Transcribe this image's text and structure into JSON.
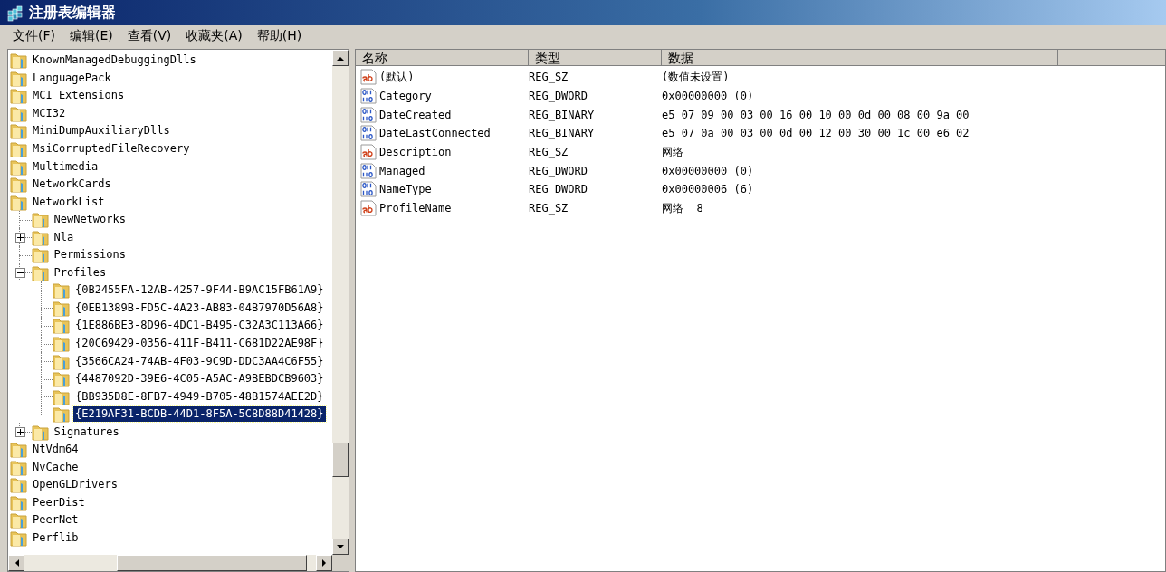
{
  "window": {
    "title": "注册表编辑器"
  },
  "menu": [
    "文件(F)",
    "编辑(E)",
    "查看(V)",
    "收藏夹(A)",
    "帮助(H)"
  ],
  "tree": {
    "items": [
      {
        "name": "KnownManagedDebuggingDlls",
        "selected": false
      },
      {
        "name": "LanguagePack",
        "selected": false
      },
      {
        "name": "MCI Extensions",
        "selected": false
      },
      {
        "name": "MCI32",
        "selected": false
      },
      {
        "name": "MiniDumpAuxiliaryDlls",
        "selected": false
      },
      {
        "name": "MsiCorruptedFileRecovery",
        "selected": false
      },
      {
        "name": "Multimedia",
        "selected": false
      },
      {
        "name": "NetworkCards",
        "selected": false
      },
      {
        "name": "NetworkList",
        "selected": false,
        "children": [
          {
            "name": "NewNetworks",
            "selected": false
          },
          {
            "name": "Nla",
            "selected": false,
            "expanded": false
          },
          {
            "name": "Permissions",
            "selected": false
          },
          {
            "name": "Profiles",
            "selected": false,
            "expanded": true,
            "children": [
              {
                "name": "{0B2455FA-12AB-4257-9F44-B9AC15FB61A9}",
                "selected": false
              },
              {
                "name": "{0EB1389B-FD5C-4A23-AB83-04B7970D56A8}",
                "selected": false
              },
              {
                "name": "{1E886BE3-8D96-4DC1-B495-C32A3C113A66}",
                "selected": false
              },
              {
                "name": "{20C69429-0356-411F-B411-C681D22AE98F}",
                "selected": false
              },
              {
                "name": "{3566CA24-74AB-4F03-9C9D-DDC3AA4C6F55}",
                "selected": false
              },
              {
                "name": "{4487092D-39E6-4C05-A5AC-A9BEBDCB9603}",
                "selected": false
              },
              {
                "name": "{BB935D8E-8FB7-4949-B705-48B1574AEE2D}",
                "selected": false
              },
              {
                "name": "{E219AF31-BCDB-44D1-8F5A-5C8D88D41428}",
                "selected": true
              }
            ]
          },
          {
            "name": "Signatures",
            "selected": false,
            "expanded": false
          }
        ]
      },
      {
        "name": "NtVdm64",
        "selected": false
      },
      {
        "name": "NvCache",
        "selected": false
      },
      {
        "name": "OpenGLDrivers",
        "selected": false
      },
      {
        "name": "PeerDist",
        "selected": false
      },
      {
        "name": "PeerNet",
        "selected": false
      },
      {
        "name": "Perflib",
        "selected": false
      }
    ]
  },
  "values": {
    "columns": [
      "名称",
      "类型",
      "数据"
    ],
    "rows": [
      {
        "kind": "string",
        "name": "(默认)",
        "type": "REG_SZ",
        "data": "(数值未设置)"
      },
      {
        "kind": "binary",
        "name": "Category",
        "type": "REG_DWORD",
        "data": "0x00000000 (0)"
      },
      {
        "kind": "binary",
        "name": "DateCreated",
        "type": "REG_BINARY",
        "data": "e5 07 09 00 03 00 16 00 10 00 0d 00 08 00 9a 00"
      },
      {
        "kind": "binary",
        "name": "DateLastConnected",
        "type": "REG_BINARY",
        "data": "e5 07 0a 00 03 00 0d 00 12 00 30 00 1c 00 e6 02"
      },
      {
        "kind": "string",
        "name": "Description",
        "type": "REG_SZ",
        "data": "网络"
      },
      {
        "kind": "binary",
        "name": "Managed",
        "type": "REG_DWORD",
        "data": "0x00000000 (0)"
      },
      {
        "kind": "binary",
        "name": "NameType",
        "type": "REG_DWORD",
        "data": "0x00000006 (6)"
      },
      {
        "kind": "string",
        "name": "ProfileName",
        "type": "REG_SZ",
        "data": "网络  8"
      }
    ]
  }
}
